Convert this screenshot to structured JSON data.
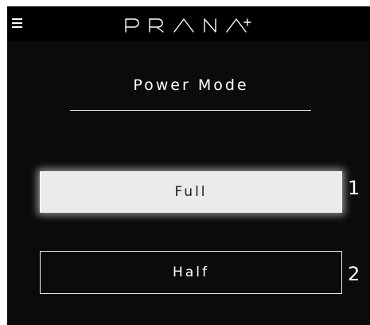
{
  "header": {
    "menu_icon": "hamburger-menu-icon",
    "brand": "PRANA+"
  },
  "main": {
    "title": "Power Mode",
    "modes": [
      {
        "label": "Full",
        "number": "1",
        "selected": true
      },
      {
        "label": "Half",
        "number": "2",
        "selected": false
      }
    ]
  },
  "colors": {
    "background": "#0b0b0b",
    "topbar": "#000000",
    "selected_fill": "#ebebeb",
    "text_light": "#ffffff",
    "text_dark": "#1a1a1a"
  }
}
